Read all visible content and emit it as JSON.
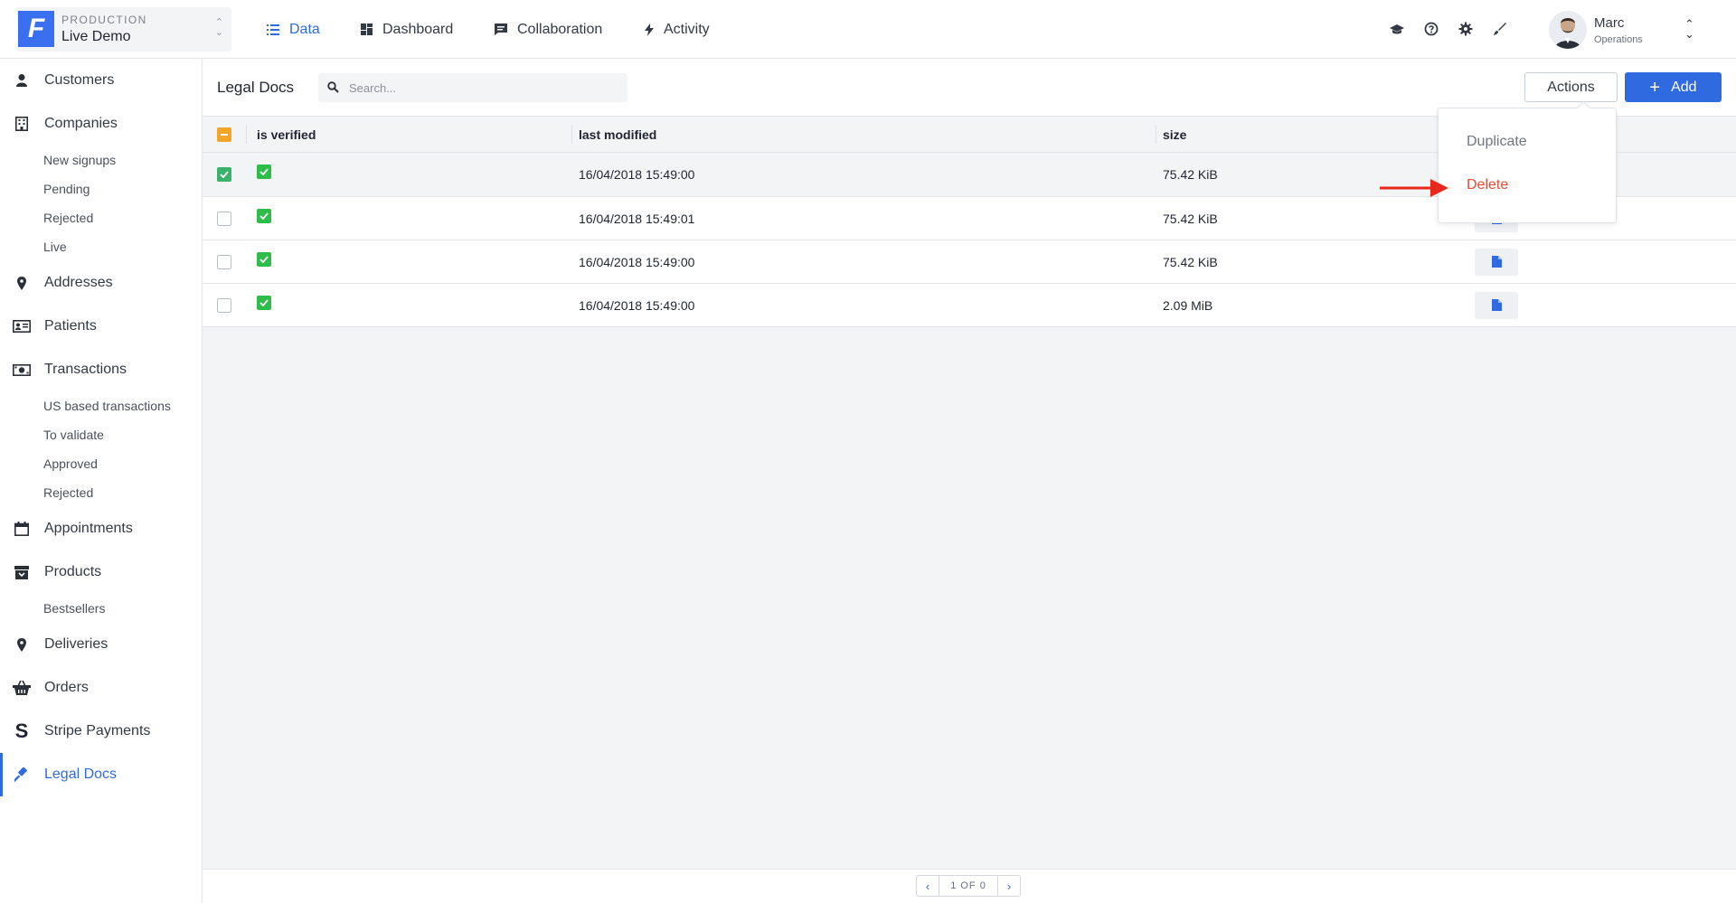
{
  "project": {
    "environment": "PRODUCTION",
    "name": "Live Demo",
    "logo_letter": "F",
    "switch_icon": "chevron-up-down-icon"
  },
  "nav": {
    "tabs": [
      {
        "label": "Data",
        "icon": "list-icon",
        "active": true
      },
      {
        "label": "Dashboard",
        "icon": "dashboard-icon",
        "active": false
      },
      {
        "label": "Collaboration",
        "icon": "chat-icon",
        "active": false
      },
      {
        "label": "Activity",
        "icon": "lightning-icon",
        "active": false
      }
    ],
    "utility_icons": [
      "graduation-cap-icon",
      "help-icon",
      "gear-icon",
      "brush-icon"
    ]
  },
  "user": {
    "name": "Marc",
    "role": "Operations"
  },
  "sidebar": {
    "items": [
      {
        "label": "Customers",
        "icon": "person-icon"
      },
      {
        "label": "Companies",
        "icon": "building-icon",
        "children": [
          "New signups",
          "Pending",
          "Rejected",
          "Live"
        ]
      },
      {
        "label": "Addresses",
        "icon": "map-pin-icon"
      },
      {
        "label": "Patients",
        "icon": "id-card-icon"
      },
      {
        "label": "Transactions",
        "icon": "money-icon",
        "children": [
          "US based transactions",
          "To validate",
          "Approved",
          "Rejected"
        ]
      },
      {
        "label": "Appointments",
        "icon": "calendar-icon"
      },
      {
        "label": "Products",
        "icon": "archive-box-icon",
        "children": [
          "Bestsellers"
        ]
      },
      {
        "label": "Deliveries",
        "icon": "map-pin-icon"
      },
      {
        "label": "Orders",
        "icon": "basket-icon"
      },
      {
        "label": "Stripe Payments",
        "icon": "stripe-icon"
      },
      {
        "label": "Legal Docs",
        "icon": "gavel-icon",
        "active": true
      }
    ]
  },
  "page": {
    "title": "Legal Docs",
    "search_placeholder": "Search...",
    "actions_label": "Actions",
    "add_label": "Add"
  },
  "table": {
    "columns": [
      "is verified",
      "last modified",
      "size"
    ],
    "rows": [
      {
        "selected": true,
        "verified": true,
        "last_modified": "16/04/2018 15:49:00",
        "size": "75.42 KiB"
      },
      {
        "selected": false,
        "verified": true,
        "last_modified": "16/04/2018 15:49:01",
        "size": "75.42 KiB"
      },
      {
        "selected": false,
        "verified": true,
        "last_modified": "16/04/2018 15:49:00",
        "size": "75.42 KiB"
      },
      {
        "selected": false,
        "verified": true,
        "last_modified": "16/04/2018 15:49:00",
        "size": "2.09 MiB"
      }
    ]
  },
  "actions_menu": {
    "items": [
      {
        "label": "Duplicate",
        "color": "#6f7681"
      },
      {
        "label": "Delete",
        "color": "#e7492f"
      }
    ]
  },
  "pagination": {
    "label": "1 OF 0"
  },
  "colors": {
    "accent": "#2f6ae0",
    "danger": "#e7492f",
    "verified": "#2ebd4a",
    "partial_check": "#f2a629",
    "annotation_arrow": "#e8291c"
  }
}
